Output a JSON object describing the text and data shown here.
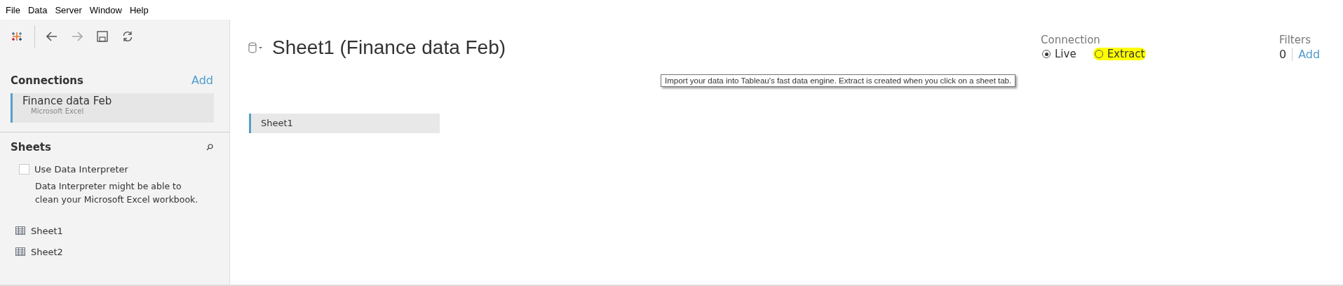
{
  "menu": [
    "File",
    "Data",
    "Server",
    "Window",
    "Help"
  ],
  "connections": {
    "title": "Connections",
    "add": "Add",
    "items": [
      {
        "name": "Finance data Feb",
        "type": "Microsoft Excel",
        "selected": true
      }
    ]
  },
  "sheets": {
    "title": "Sheets",
    "interpreter": {
      "label": "Use Data Interpreter",
      "checked": false,
      "description": "Data Interpreter might be able to clean your Microsoft Excel workbook."
    },
    "items": [
      {
        "name": "Sheet1"
      },
      {
        "name": "Sheet2"
      }
    ]
  },
  "main": {
    "title": "Sheet1 (Finance data Feb)",
    "connection": {
      "label": "Connection",
      "options": [
        {
          "label": "Live",
          "selected": true,
          "highlighted": false
        },
        {
          "label": "Extract",
          "selected": false,
          "highlighted": true
        }
      ]
    },
    "filters": {
      "label": "Filters",
      "count": "0",
      "add": "Add"
    },
    "tooltip": "Import your data into Tableau's fast data engine. Extract is created when you click on a sheet tab.",
    "canvas_tables": [
      {
        "name": "Sheet1"
      }
    ]
  }
}
